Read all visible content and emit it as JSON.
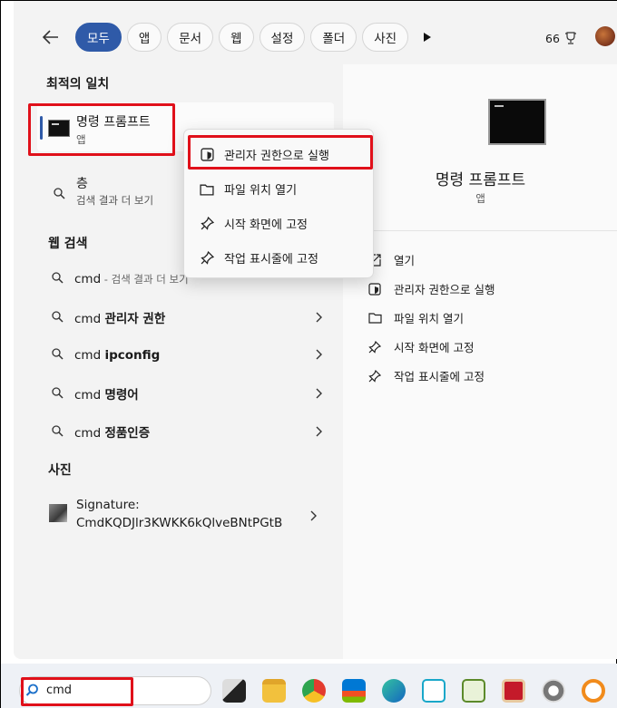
{
  "tabs": [
    {
      "label": "모두",
      "active": true
    },
    {
      "label": "앱"
    },
    {
      "label": "문서"
    },
    {
      "label": "웹"
    },
    {
      "label": "설정"
    },
    {
      "label": "폴더"
    },
    {
      "label": "사진"
    }
  ],
  "header": {
    "points": "66"
  },
  "best_match": {
    "heading": "최적의 일치",
    "title": "명령 프롬프트",
    "subtitle": "앱"
  },
  "search_suggestion": {
    "title": "층",
    "subtitle": "검색 결과 더 보기"
  },
  "web_search": {
    "heading": "웹 검색",
    "items": [
      {
        "prefix": "cmd",
        "suffix": " - 검색 결과 더 보기"
      },
      {
        "prefix": "cmd ",
        "bold": "관리자 권한"
      },
      {
        "prefix": "cmd ",
        "bold": "ipconfig"
      },
      {
        "prefix": "cmd ",
        "bold": "명령어"
      },
      {
        "prefix": "cmd ",
        "bold": "정품인증"
      }
    ]
  },
  "photos": {
    "heading": "사진",
    "item_line1": "Signature:",
    "item_line2": "CmdKQDJlr3KWKK6kQlveBNtPGtB"
  },
  "context_menu": {
    "items": [
      "관리자 권한으로 실행",
      "파일 위치 열기",
      "시작 화면에 고정",
      "작업 표시줄에 고정"
    ]
  },
  "preview": {
    "title": "명령 프롬프트",
    "subtitle": "앱",
    "actions": [
      "열기",
      "관리자 권한으로 실행",
      "파일 위치 열기",
      "시작 화면에 고정",
      "작업 표시줄에 고정"
    ]
  },
  "taskbar": {
    "search_value": "cmd"
  },
  "colors": {
    "accent": "#2f5aa8",
    "highlight": "#e0101a"
  }
}
